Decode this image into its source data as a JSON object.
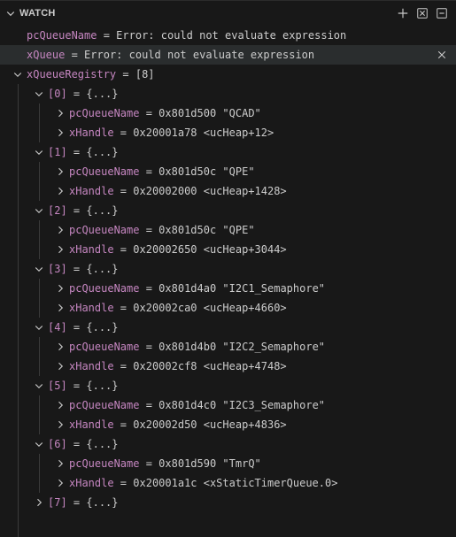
{
  "panel": {
    "title": "WATCH",
    "actions": [
      "add-expression-icon",
      "collapse-all-icon",
      "remove-all-icon"
    ]
  },
  "watch": {
    "rows": [
      {
        "name": "pcQueueName",
        "sep": " = ",
        "value": "Error: could not evaluate expression"
      },
      {
        "name": "xQueue",
        "sep": " = ",
        "value": "Error: could not evaluate expression"
      },
      {
        "name": "xQueueRegistry",
        "sep": " = ",
        "value": "[8]"
      }
    ],
    "registry": [
      {
        "index": "[0]",
        "value": "{...}",
        "pcQueueName": "0x801d500 \"QCAD\"",
        "xHandle": "0x20001a78 <ucHeap+12>"
      },
      {
        "index": "[1]",
        "value": "{...}",
        "pcQueueName": "0x801d50c \"QPE\"",
        "xHandle": "0x20002000 <ucHeap+1428>"
      },
      {
        "index": "[2]",
        "value": "{...}",
        "pcQueueName": "0x801d50c \"QPE\"",
        "xHandle": "0x20002650 <ucHeap+3044>"
      },
      {
        "index": "[3]",
        "value": "{...}",
        "pcQueueName": "0x801d4a0 \"I2C1_Semaphore\"",
        "xHandle": "0x20002ca0 <ucHeap+4660>"
      },
      {
        "index": "[4]",
        "value": "{...}",
        "pcQueueName": "0x801d4b0 \"I2C2_Semaphore\"",
        "xHandle": "0x20002cf8 <ucHeap+4748>"
      },
      {
        "index": "[5]",
        "value": "{...}",
        "pcQueueName": "0x801d4c0 \"I2C3_Semaphore\"",
        "xHandle": "0x20002d50 <ucHeap+4836>"
      },
      {
        "index": "[6]",
        "value": "{...}",
        "pcQueueName": "0x801d590 \"TmrQ\"",
        "xHandle": "0x20001a1c <xStaticTimerQueue.0>"
      },
      {
        "index": "[7]",
        "value": "{...}"
      }
    ],
    "field_names": {
      "pcQueueName": "pcQueueName",
      "xHandle": "xHandle"
    },
    "eq": " = "
  }
}
